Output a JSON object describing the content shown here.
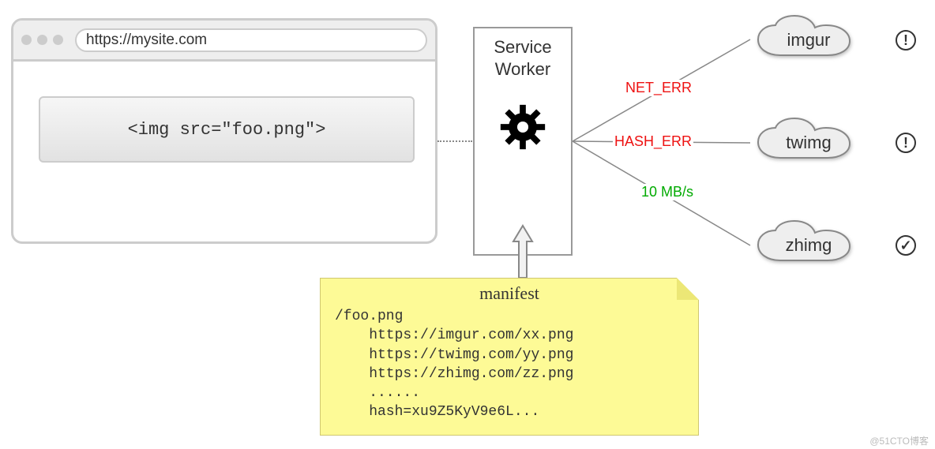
{
  "browser": {
    "url": "https://mysite.com",
    "img_tag": "<img src=\"foo.png\">"
  },
  "service_worker": {
    "line1": "Service",
    "line2": "Worker"
  },
  "edges": {
    "err_net": "NET_ERR",
    "err_hash": "HASH_ERR",
    "bw": "10 MB/s"
  },
  "clouds": {
    "c1": {
      "name": "imgur",
      "status": "error"
    },
    "c2": {
      "name": "twimg",
      "status": "error"
    },
    "c3": {
      "name": "zhimg",
      "status": "ok"
    }
  },
  "manifest": {
    "title": "manifest",
    "lines": [
      "/foo.png",
      "    https://imgur.com/xx.png",
      "    https://twimg.com/yy.png",
      "    https://zhimg.com/zz.png",
      "    ......",
      "    hash=xu9Z5KyV9e6L..."
    ]
  },
  "status_glyphs": {
    "error": "!",
    "ok": "✓"
  },
  "footer": "@51CTO博客"
}
